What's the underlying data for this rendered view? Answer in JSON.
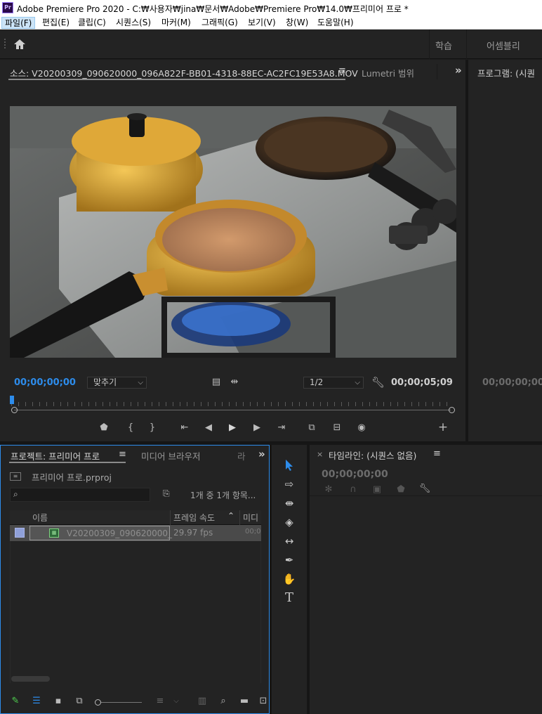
{
  "titlebar": {
    "app_icon": "Pr",
    "title": "Adobe Premiere Pro 2020 - C:₩사용자₩jina₩문서₩Adobe₩Premiere Pro₩14.0₩프리미어 프로 *"
  },
  "menu": [
    {
      "label": "파일(F)"
    },
    {
      "label": "편집(E)"
    },
    {
      "label": "클립(C)"
    },
    {
      "label": "시퀀스(S)"
    },
    {
      "label": "마커(M)"
    },
    {
      "label": "그래픽(G)"
    },
    {
      "label": "보기(V)"
    },
    {
      "label": "창(W)"
    },
    {
      "label": "도움말(H)"
    }
  ],
  "workspaces": {
    "learn": "학습",
    "assembly": "어셈블리"
  },
  "source_panel": {
    "tab_label": "소스: V20200309_090620000_096A822F-BB01-4318-88EC-AC2FC19E53A8.MOV",
    "menu_glyph": "≡",
    "lumetri_label": "Lumetri 범위",
    "overflow_glyph": "»",
    "timecode_current": "00;00;00;00",
    "fit_value": "맞추기",
    "resolution_value": "1/2",
    "timecode_duration": "00;00;05;09"
  },
  "program_panel": {
    "tab_label": "프로그램: (시퀀",
    "timecode": "00;00;00;00"
  },
  "project_panel": {
    "tab_label": "프로젝트: 프리미어 프로",
    "menu_glyph": "≡",
    "media_browser_label": "미디어 브라우저",
    "extra_tab_glyph": "라",
    "overflow_glyph": "»",
    "project_file": "프리미어 프로.prproj",
    "search_placeholder": "",
    "item_count": "1개 중 1개 항목...",
    "columns": {
      "name": "이름",
      "frame_rate": "프레임 속도",
      "media": "미디"
    },
    "rows": [
      {
        "name": "V20200309_090620000_",
        "frame_rate": "29.97 fps",
        "media": "00;0"
      }
    ]
  },
  "timeline_panel": {
    "close_glyph": "×",
    "tab_label": "타임라인: (시퀀스 없음)",
    "menu_glyph": "≡",
    "timecode": "00;00;00;00"
  },
  "colors": {
    "accent_blue": "#2d8ceb",
    "panel_bg": "#232323",
    "app_bg": "#1d1d1d",
    "label_swatch": "#8fa0d8"
  },
  "icons": {
    "home": "home-icon",
    "tools": [
      "selection-tool-icon",
      "track-select-tool-icon",
      "ripple-edit-tool-icon",
      "razor-tool-icon",
      "slip-tool-icon",
      "pen-tool-icon",
      "hand-tool-icon",
      "type-tool-icon"
    ]
  }
}
